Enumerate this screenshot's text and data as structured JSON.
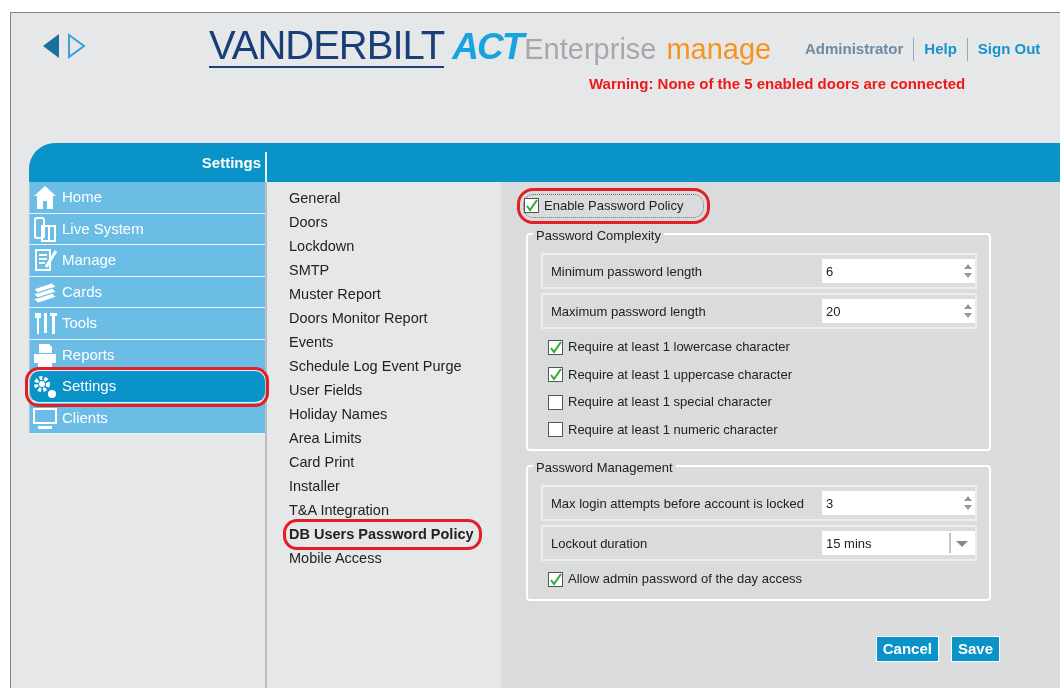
{
  "logo": {
    "brand": "VANDERBILT",
    "product": "ACT",
    "edition": "Enterprise",
    "module": "manage"
  },
  "top_links": [
    {
      "kind": "user",
      "label": "Administrator"
    },
    {
      "kind": "link",
      "label": "Help"
    },
    {
      "kind": "link",
      "label": "Sign Out"
    }
  ],
  "warning": "Warning: None of the 5 enabled doors are connected",
  "section_title": "Settings",
  "sidebar": {
    "items": [
      {
        "label": "Home",
        "selected": false,
        "highlighted": false
      },
      {
        "label": "Live System",
        "selected": false,
        "highlighted": false
      },
      {
        "label": "Manage",
        "selected": false,
        "highlighted": false
      },
      {
        "label": "Cards",
        "selected": false,
        "highlighted": false
      },
      {
        "label": "Tools",
        "selected": false,
        "highlighted": false
      },
      {
        "label": "Reports",
        "selected": false,
        "highlighted": false
      },
      {
        "label": "Settings",
        "selected": true,
        "highlighted": true
      },
      {
        "label": "Clients",
        "selected": false,
        "highlighted": false
      }
    ]
  },
  "subnav": {
    "items": [
      {
        "label": "General",
        "selected": false,
        "highlighted": false
      },
      {
        "label": "Doors",
        "selected": false,
        "highlighted": false
      },
      {
        "label": "Lockdown",
        "selected": false,
        "highlighted": false
      },
      {
        "label": "SMTP",
        "selected": false,
        "highlighted": false
      },
      {
        "label": "Muster Report",
        "selected": false,
        "highlighted": false
      },
      {
        "label": "Doors Monitor Report",
        "selected": false,
        "highlighted": false
      },
      {
        "label": "Events",
        "selected": false,
        "highlighted": false
      },
      {
        "label": "Schedule Log Event Purge",
        "selected": false,
        "highlighted": false
      },
      {
        "label": "User Fields",
        "selected": false,
        "highlighted": false
      },
      {
        "label": "Holiday Names",
        "selected": false,
        "highlighted": false
      },
      {
        "label": "Area Limits",
        "selected": false,
        "highlighted": false
      },
      {
        "label": "Card Print",
        "selected": false,
        "highlighted": false
      },
      {
        "label": "Installer",
        "selected": false,
        "highlighted": false
      },
      {
        "label": "T&A Integration",
        "selected": false,
        "highlighted": false
      },
      {
        "label": "DB Users Password Policy",
        "selected": true,
        "highlighted": true
      },
      {
        "label": "Mobile Access",
        "selected": false,
        "highlighted": false
      }
    ]
  },
  "form": {
    "enable": {
      "label": "Enable Password Policy",
      "checked": true,
      "highlighted": true
    },
    "groups": [
      {
        "legend": "Password Complexity",
        "rows": [
          {
            "kind": "number",
            "label": "Minimum password length",
            "value": "6"
          },
          {
            "kind": "number",
            "label": "Maximum password length",
            "value": "20"
          },
          {
            "kind": "checkbox",
            "label": "Require at least 1 lowercase character",
            "checked": true
          },
          {
            "kind": "checkbox",
            "label": "Require at least 1 uppercase character",
            "checked": true
          },
          {
            "kind": "checkbox",
            "label": "Require at least 1 special character",
            "checked": false
          },
          {
            "kind": "checkbox",
            "label": "Require at least 1 numeric character",
            "checked": false
          }
        ]
      },
      {
        "legend": "Password Management",
        "rows": [
          {
            "kind": "number",
            "label": "Max login attempts before account is locked",
            "value": "3"
          },
          {
            "kind": "select",
            "label": "Lockout duration",
            "value": "15 mins"
          },
          {
            "kind": "checkbox",
            "label": "Allow admin password of the day access",
            "checked": true
          }
        ]
      }
    ],
    "buttons": [
      "Cancel",
      "Save"
    ]
  }
}
